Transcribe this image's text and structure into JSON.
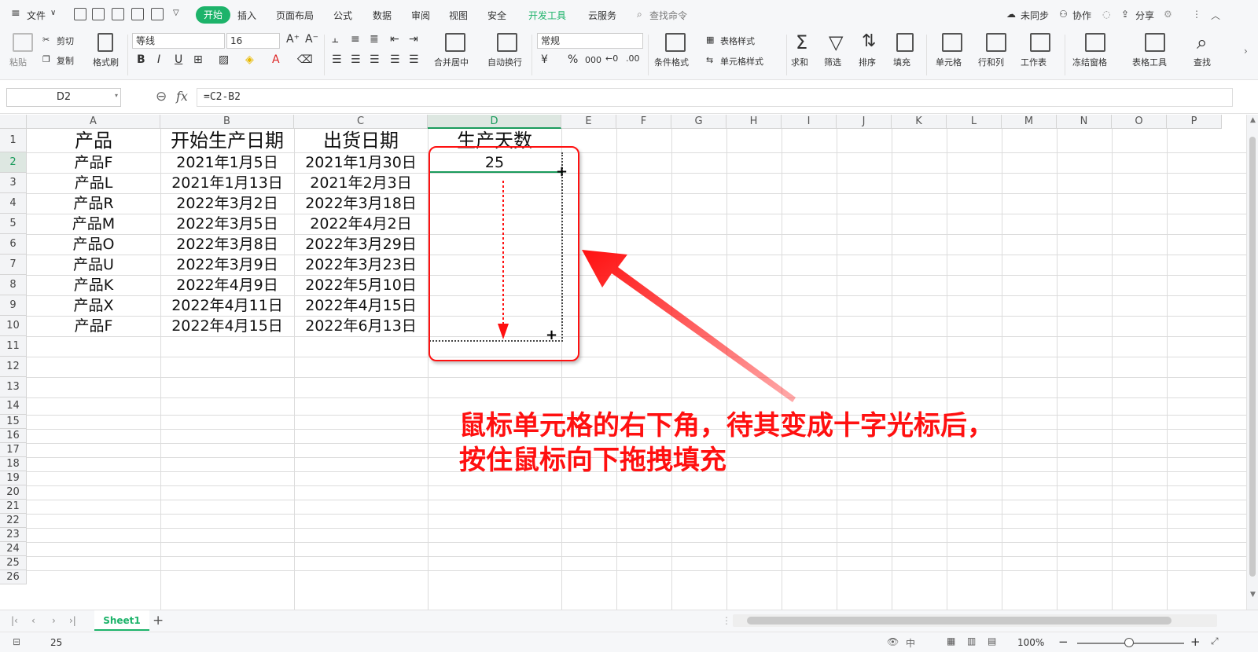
{
  "menu": {
    "file": "文件",
    "tabs": [
      "开始",
      "插入",
      "页面布局",
      "公式",
      "数据",
      "审阅",
      "视图",
      "安全",
      "开发工具",
      "云服务"
    ],
    "search": "查找命令",
    "right": [
      "未同步",
      "协作",
      "分享"
    ]
  },
  "ribbon": {
    "paste": "粘贴",
    "cut": "剪切",
    "copy": "复制",
    "format_painter": "格式刷",
    "font_name": "等线",
    "font_size": "16",
    "bold": "B",
    "italic": "I",
    "underline": "U",
    "merge": "合并居中",
    "wrap": "自动换行",
    "number_format": "常规",
    "currency": "¥",
    "percent": "%",
    "thousands": "000",
    "cond_format": "条件格式",
    "table_style": "表格样式",
    "cell_style": "单元格样式",
    "sum": "求和",
    "filter": "筛选",
    "sort": "排序",
    "fill": "填充",
    "cells": "单元格",
    "rowcol": "行和列",
    "sheet": "工作表",
    "freeze": "冻结窗格",
    "tabletools": "表格工具",
    "find": "查找"
  },
  "formula_bar": {
    "name_box": "D2",
    "fx": "fx",
    "formula": "=C2-B2"
  },
  "columns": [
    "A",
    "B",
    "C",
    "D",
    "E",
    "F",
    "G",
    "H",
    "I",
    "J",
    "K",
    "L",
    "M",
    "N",
    "O",
    "P"
  ],
  "rows": [
    "1",
    "2",
    "3",
    "4",
    "5",
    "6",
    "7",
    "8",
    "9",
    "10",
    "11",
    "12",
    "13",
    "14",
    "15",
    "16",
    "17",
    "18",
    "19",
    "20",
    "21",
    "22",
    "23",
    "24",
    "25",
    "26"
  ],
  "table": {
    "headers": [
      "产品",
      "开始生产日期",
      "出货日期",
      "生产天数"
    ],
    "rows": [
      [
        "产品F",
        "2021年1月5日",
        "2021年1月30日",
        "25"
      ],
      [
        "产品L",
        "2021年1月13日",
        "2021年2月3日",
        ""
      ],
      [
        "产品R",
        "2022年3月2日",
        "2022年3月18日",
        ""
      ],
      [
        "产品M",
        "2022年3月5日",
        "2022年4月2日",
        ""
      ],
      [
        "产品O",
        "2022年3月8日",
        "2022年3月29日",
        ""
      ],
      [
        "产品U",
        "2022年3月9日",
        "2022年3月23日",
        ""
      ],
      [
        "产品K",
        "2022年4月9日",
        "2022年5月10日",
        ""
      ],
      [
        "产品X",
        "2022年4月11日",
        "2022年4月15日",
        ""
      ],
      [
        "产品F",
        "2022年4月15日",
        "2022年6月13日",
        ""
      ]
    ]
  },
  "annotation": {
    "line1": "鼠标单元格的右下角，待其变成十字光标后，",
    "line2": "按住鼠标向下拖拽填充",
    "color": "#ff1010"
  },
  "sheet_tabs": [
    "Sheet1"
  ],
  "status": {
    "value": "25",
    "zoom": "100%"
  },
  "colors": {
    "accent": "#1db36a",
    "selection": "#1a9b5c",
    "annotation": "#ff1010"
  }
}
